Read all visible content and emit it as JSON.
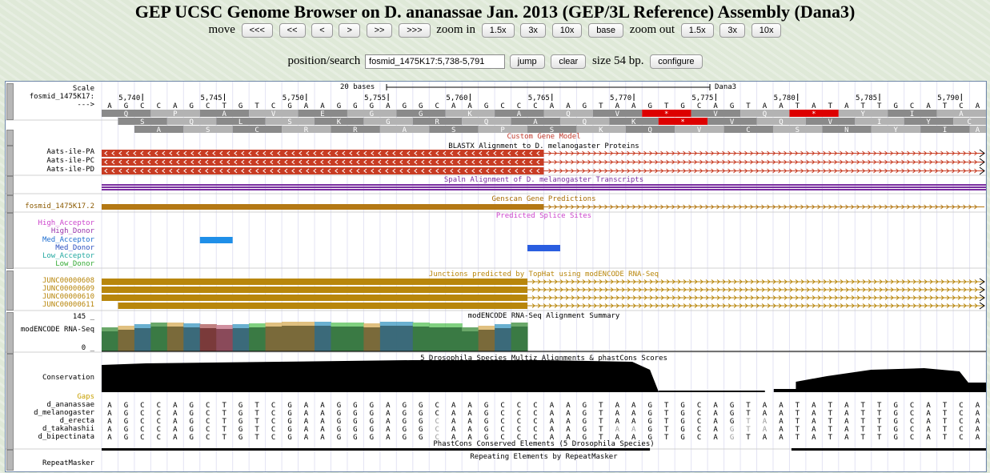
{
  "page_title": "GEP UCSC Genome Browser on D. ananassae Jan. 2013 (GEP/3L Reference) Assembly (Dana3)",
  "nav": {
    "move_label": "move",
    "move_buttons": [
      "<<<",
      "<<",
      "<",
      ">",
      ">>",
      ">>>"
    ],
    "zoom_in_label": "zoom in",
    "zoom_in_buttons": [
      "1.5x",
      "3x",
      "10x",
      "base"
    ],
    "zoom_out_label": "zoom out",
    "zoom_out_buttons": [
      "1.5x",
      "3x",
      "10x"
    ]
  },
  "search": {
    "label": "position/search",
    "value": "fosmid_1475K17:5,738-5,791",
    "jump_label": "jump",
    "clear_label": "clear",
    "size_text": "size 54 bp.",
    "configure_label": "configure"
  },
  "ruler": {
    "scale_label": "Scale",
    "scale_text": "20 bases",
    "assembly": "Dana3",
    "chrom_label": "fosmid_1475K17:",
    "arrow_label": "--->",
    "ticks": [
      "5,740",
      "5,745",
      "5,750",
      "5,755",
      "5,760",
      "5,765",
      "5,770",
      "5,775",
      "5,780",
      "5,785",
      "5,790"
    ]
  },
  "sequence": "AGCCAGCTGTCGAAGGGAGGCAAGCCCAAGTAAGTGCAGTAATATATTGCATCAGCC",
  "frames": [
    [
      "Q",
      "",
      "S",
      "",
      "",
      "",
      "",
      "",
      "",
      "",
      "",
      "",
      "",
      "",
      "",
      "",
      "",
      "",
      "",
      "Q",
      "",
      "",
      "",
      "",
      "",
      "",
      "",
      "",
      "",
      "",
      "",
      "",
      "",
      "",
      "",
      "",
      "",
      "",
      "",
      "",
      "",
      "",
      "",
      "",
      "",
      "",
      "",
      "",
      "",
      "",
      "",
      "",
      "",
      "",
      "",
      ""
    ],
    [],
    []
  ],
  "aa_frame1": [
    "Q",
    "P",
    "A",
    "V",
    "E",
    "G",
    "G",
    "K",
    "A",
    "Q",
    "V",
    "*",
    "V",
    "Q",
    "*",
    "Y",
    "I",
    "A",
    "S",
    "A"
  ],
  "aa_frame2": [
    "S",
    "Q",
    "L",
    "S",
    "K",
    "G",
    "R",
    "Q",
    "A",
    "Q",
    "K",
    "*",
    "V",
    "Q",
    "V",
    "I",
    "Y",
    "C",
    "I",
    "S"
  ],
  "aa_frame3": [
    "A",
    "S",
    "C",
    "R",
    "R",
    "A",
    "S",
    "P",
    "S",
    "K",
    "Q",
    "V",
    "C",
    "S",
    "N",
    "Y",
    "I",
    "A",
    "H",
    "Q",
    "P"
  ],
  "tracks": {
    "custom_gene_model": "Custom Gene Model",
    "blastx_title": "BLASTX Alignment to D. melanogaster Proteins",
    "blastx_items": [
      "Aats-ile-PA",
      "Aats-ile-PC",
      "Aats-ile-PD"
    ],
    "spaln_title": "Spaln Alignment of D. melanogaster Transcripts",
    "genscan_title": "Genscan Gene Predictions",
    "genscan_item": "fosmid_1475K17.2",
    "splice_title": "Predicted Splice Sites",
    "splice_items": [
      "High_Acceptor",
      "High_Donor",
      "Med_Acceptor",
      "Med_Donor",
      "Low_Acceptor",
      "Low_Donor"
    ],
    "junctions_title": "Junctions predicted by TopHat using modENCODE RNA-Seq",
    "junction_items": [
      "JUNC00000608",
      "JUNC00000609",
      "JUNC00000610",
      "JUNC00000611"
    ],
    "rnaseq_title": "modENCODE RNA-Seq Alignment Summary",
    "rnaseq_label": "modENCODE RNA-Seq",
    "rnaseq_max": "145 _",
    "rnaseq_min": "0 _",
    "multiz_title": "5 Drosophila Species Multiz Alignments & phastCons Scores",
    "conservation_label": "Conservation",
    "gaps_label": "Gaps",
    "species": [
      "d_ananassae",
      "d_melanogaster",
      "d_erecta",
      "d_takahashii",
      "d_bipectinata"
    ],
    "phastcons_title": "PhastCons Conserved Elements (5 Drosophila Species)",
    "repeat_title": "Repeating Elements by RepeatMasker",
    "repeat_label": "RepeatMasker"
  },
  "colors": {
    "blastx": "#c83c23",
    "spaln": "#7a2fa0",
    "genscan": "#b47814",
    "junction": "#b8860b",
    "splice_high_acceptor": "#cc44cc",
    "splice_high_donor": "#9933aa",
    "splice_med_acceptor": "#1f8fe8",
    "splice_med_donor": "#2a5ee0",
    "splice_low_acceptor": "#22b8b0",
    "splice_low_donor": "#33bb33",
    "stop_codon": "#dd0000"
  }
}
